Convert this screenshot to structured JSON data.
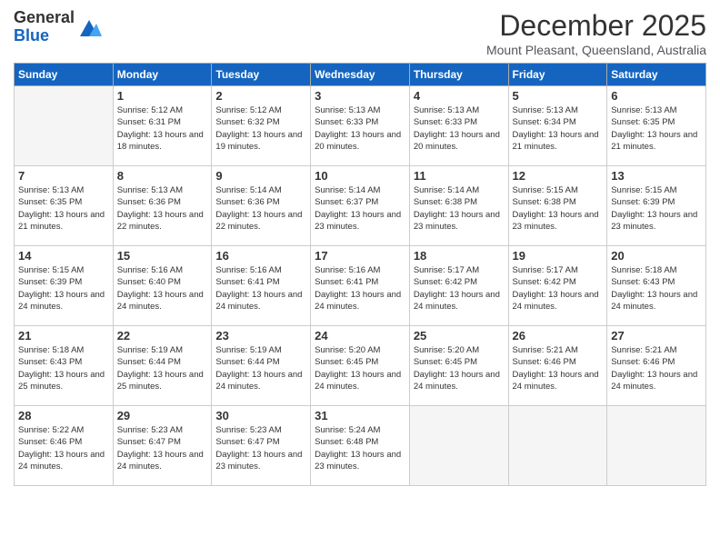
{
  "logo": {
    "general": "General",
    "blue": "Blue"
  },
  "header": {
    "month": "December 2025",
    "location": "Mount Pleasant, Queensland, Australia"
  },
  "days_of_week": [
    "Sunday",
    "Monday",
    "Tuesday",
    "Wednesday",
    "Thursday",
    "Friday",
    "Saturday"
  ],
  "weeks": [
    [
      {
        "day": "",
        "sunrise": "",
        "sunset": "",
        "daylight": "",
        "empty": true
      },
      {
        "day": "1",
        "sunrise": "Sunrise: 5:12 AM",
        "sunset": "Sunset: 6:31 PM",
        "daylight": "Daylight: 13 hours and 18 minutes."
      },
      {
        "day": "2",
        "sunrise": "Sunrise: 5:12 AM",
        "sunset": "Sunset: 6:32 PM",
        "daylight": "Daylight: 13 hours and 19 minutes."
      },
      {
        "day": "3",
        "sunrise": "Sunrise: 5:13 AM",
        "sunset": "Sunset: 6:33 PM",
        "daylight": "Daylight: 13 hours and 20 minutes."
      },
      {
        "day": "4",
        "sunrise": "Sunrise: 5:13 AM",
        "sunset": "Sunset: 6:33 PM",
        "daylight": "Daylight: 13 hours and 20 minutes."
      },
      {
        "day": "5",
        "sunrise": "Sunrise: 5:13 AM",
        "sunset": "Sunset: 6:34 PM",
        "daylight": "Daylight: 13 hours and 21 minutes."
      },
      {
        "day": "6",
        "sunrise": "Sunrise: 5:13 AM",
        "sunset": "Sunset: 6:35 PM",
        "daylight": "Daylight: 13 hours and 21 minutes."
      }
    ],
    [
      {
        "day": "7",
        "sunrise": "Sunrise: 5:13 AM",
        "sunset": "Sunset: 6:35 PM",
        "daylight": "Daylight: 13 hours and 21 minutes."
      },
      {
        "day": "8",
        "sunrise": "Sunrise: 5:13 AM",
        "sunset": "Sunset: 6:36 PM",
        "daylight": "Daylight: 13 hours and 22 minutes."
      },
      {
        "day": "9",
        "sunrise": "Sunrise: 5:14 AM",
        "sunset": "Sunset: 6:36 PM",
        "daylight": "Daylight: 13 hours and 22 minutes."
      },
      {
        "day": "10",
        "sunrise": "Sunrise: 5:14 AM",
        "sunset": "Sunset: 6:37 PM",
        "daylight": "Daylight: 13 hours and 23 minutes."
      },
      {
        "day": "11",
        "sunrise": "Sunrise: 5:14 AM",
        "sunset": "Sunset: 6:38 PM",
        "daylight": "Daylight: 13 hours and 23 minutes."
      },
      {
        "day": "12",
        "sunrise": "Sunrise: 5:15 AM",
        "sunset": "Sunset: 6:38 PM",
        "daylight": "Daylight: 13 hours and 23 minutes."
      },
      {
        "day": "13",
        "sunrise": "Sunrise: 5:15 AM",
        "sunset": "Sunset: 6:39 PM",
        "daylight": "Daylight: 13 hours and 23 minutes."
      }
    ],
    [
      {
        "day": "14",
        "sunrise": "Sunrise: 5:15 AM",
        "sunset": "Sunset: 6:39 PM",
        "daylight": "Daylight: 13 hours and 24 minutes."
      },
      {
        "day": "15",
        "sunrise": "Sunrise: 5:16 AM",
        "sunset": "Sunset: 6:40 PM",
        "daylight": "Daylight: 13 hours and 24 minutes."
      },
      {
        "day": "16",
        "sunrise": "Sunrise: 5:16 AM",
        "sunset": "Sunset: 6:41 PM",
        "daylight": "Daylight: 13 hours and 24 minutes."
      },
      {
        "day": "17",
        "sunrise": "Sunrise: 5:16 AM",
        "sunset": "Sunset: 6:41 PM",
        "daylight": "Daylight: 13 hours and 24 minutes."
      },
      {
        "day": "18",
        "sunrise": "Sunrise: 5:17 AM",
        "sunset": "Sunset: 6:42 PM",
        "daylight": "Daylight: 13 hours and 24 minutes."
      },
      {
        "day": "19",
        "sunrise": "Sunrise: 5:17 AM",
        "sunset": "Sunset: 6:42 PM",
        "daylight": "Daylight: 13 hours and 24 minutes."
      },
      {
        "day": "20",
        "sunrise": "Sunrise: 5:18 AM",
        "sunset": "Sunset: 6:43 PM",
        "daylight": "Daylight: 13 hours and 24 minutes."
      }
    ],
    [
      {
        "day": "21",
        "sunrise": "Sunrise: 5:18 AM",
        "sunset": "Sunset: 6:43 PM",
        "daylight": "Daylight: 13 hours and 25 minutes."
      },
      {
        "day": "22",
        "sunrise": "Sunrise: 5:19 AM",
        "sunset": "Sunset: 6:44 PM",
        "daylight": "Daylight: 13 hours and 25 minutes."
      },
      {
        "day": "23",
        "sunrise": "Sunrise: 5:19 AM",
        "sunset": "Sunset: 6:44 PM",
        "daylight": "Daylight: 13 hours and 24 minutes."
      },
      {
        "day": "24",
        "sunrise": "Sunrise: 5:20 AM",
        "sunset": "Sunset: 6:45 PM",
        "daylight": "Daylight: 13 hours and 24 minutes."
      },
      {
        "day": "25",
        "sunrise": "Sunrise: 5:20 AM",
        "sunset": "Sunset: 6:45 PM",
        "daylight": "Daylight: 13 hours and 24 minutes."
      },
      {
        "day": "26",
        "sunrise": "Sunrise: 5:21 AM",
        "sunset": "Sunset: 6:46 PM",
        "daylight": "Daylight: 13 hours and 24 minutes."
      },
      {
        "day": "27",
        "sunrise": "Sunrise: 5:21 AM",
        "sunset": "Sunset: 6:46 PM",
        "daylight": "Daylight: 13 hours and 24 minutes."
      }
    ],
    [
      {
        "day": "28",
        "sunrise": "Sunrise: 5:22 AM",
        "sunset": "Sunset: 6:46 PM",
        "daylight": "Daylight: 13 hours and 24 minutes."
      },
      {
        "day": "29",
        "sunrise": "Sunrise: 5:23 AM",
        "sunset": "Sunset: 6:47 PM",
        "daylight": "Daylight: 13 hours and 24 minutes."
      },
      {
        "day": "30",
        "sunrise": "Sunrise: 5:23 AM",
        "sunset": "Sunset: 6:47 PM",
        "daylight": "Daylight: 13 hours and 23 minutes."
      },
      {
        "day": "31",
        "sunrise": "Sunrise: 5:24 AM",
        "sunset": "Sunset: 6:48 PM",
        "daylight": "Daylight: 13 hours and 23 minutes."
      },
      {
        "day": "",
        "sunrise": "",
        "sunset": "",
        "daylight": "",
        "empty": true
      },
      {
        "day": "",
        "sunrise": "",
        "sunset": "",
        "daylight": "",
        "empty": true
      },
      {
        "day": "",
        "sunrise": "",
        "sunset": "",
        "daylight": "",
        "empty": true
      }
    ]
  ]
}
